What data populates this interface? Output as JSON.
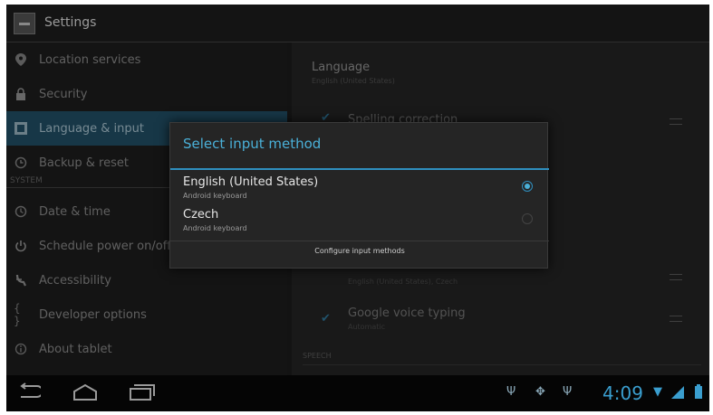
{
  "app": {
    "title": "Settings"
  },
  "left_menu": {
    "items_top": [
      {
        "label": "Location services",
        "icon": "location-icon"
      },
      {
        "label": "Security",
        "icon": "lock-icon"
      },
      {
        "label": "Language & input",
        "icon": "keyboard-icon",
        "active": true
      },
      {
        "label": "Backup & reset",
        "icon": "backup-icon"
      }
    ],
    "section_header": "SYSTEM",
    "items_system": [
      {
        "label": "Date & time",
        "icon": "clock-icon"
      },
      {
        "label": "Schedule power on/off",
        "icon": "power-icon"
      },
      {
        "label": "Accessibility",
        "icon": "accessibility-icon"
      },
      {
        "label": "Developer options",
        "icon": "braces-icon"
      },
      {
        "label": "About tablet",
        "icon": "info-icon"
      }
    ]
  },
  "right_pane": {
    "language_title": "Language",
    "language_value": "English (United States)",
    "spelling_label": "Spelling correction",
    "keyboard_sub": "English (United States), Czech",
    "voice_label": "Google voice typing",
    "voice_sub": "Automatic",
    "speech_header": "SPEECH"
  },
  "dialog": {
    "title": "Select input method",
    "options": [
      {
        "name": "English (United States)",
        "sub": "Android keyboard",
        "selected": true
      },
      {
        "name": "Czech",
        "sub": "Android keyboard",
        "selected": false
      }
    ],
    "configure_label": "Configure input methods"
  },
  "navbar": {
    "time": "4:09",
    "icons": [
      "back-icon",
      "home-icon",
      "recent-apps-icon",
      "usb-icon",
      "debug-icon",
      "usb-icon",
      "wifi-icon",
      "signal-icon",
      "battery-icon"
    ]
  },
  "colors": {
    "accent": "#4ab0d8",
    "active_item_bg": "#1f4a5f",
    "background": "#1a1a1a"
  }
}
